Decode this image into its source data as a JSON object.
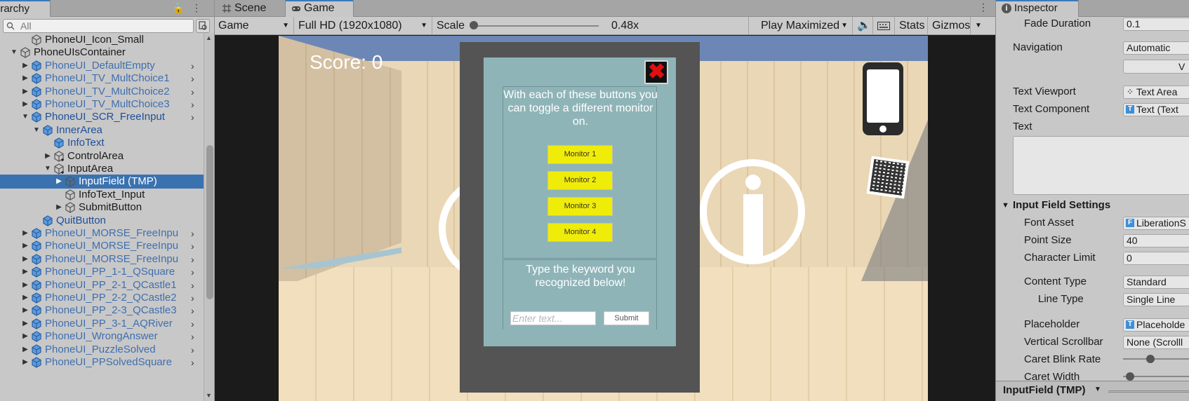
{
  "hierarchy": {
    "tab_label": "erarchy",
    "search_placeholder": "All",
    "rows": [
      {
        "label": "PhoneUI_Icon_Small",
        "depth": 2,
        "arrow": "",
        "kind": "object"
      },
      {
        "label": "PhoneUIsContainer",
        "depth": 1,
        "arrow": "down",
        "kind": "object"
      },
      {
        "label": "PhoneUI_DefaultEmpty",
        "depth": 2,
        "arrow": "right",
        "kind": "prefab",
        "chev": true
      },
      {
        "label": "PhoneUI_TV_MultChoice1",
        "depth": 2,
        "arrow": "right",
        "kind": "prefab",
        "chev": true
      },
      {
        "label": "PhoneUI_TV_MultChoice2",
        "depth": 2,
        "arrow": "right",
        "kind": "prefab",
        "chev": true
      },
      {
        "label": "PhoneUI_TV_MultChoice3",
        "depth": 2,
        "arrow": "right",
        "kind": "prefab",
        "chev": true
      },
      {
        "label": "PhoneUI_SCR_FreeInput",
        "depth": 2,
        "arrow": "down",
        "kind": "prefab-dark",
        "chev": true
      },
      {
        "label": "InnerArea",
        "depth": 3,
        "arrow": "down",
        "kind": "prefab-dark"
      },
      {
        "label": "InfoText",
        "depth": 4,
        "arrow": "",
        "kind": "prefab-dark"
      },
      {
        "label": "ControlArea",
        "depth": 4,
        "arrow": "right",
        "kind": "object-plus"
      },
      {
        "label": "InputArea",
        "depth": 4,
        "arrow": "down",
        "kind": "object-plus"
      },
      {
        "label": "InputField (TMP)",
        "depth": 5,
        "arrow": "right",
        "kind": "object",
        "selected": true
      },
      {
        "label": "InfoText_Input",
        "depth": 5,
        "arrow": "",
        "kind": "object"
      },
      {
        "label": "SubmitButton",
        "depth": 5,
        "arrow": "right",
        "kind": "object"
      },
      {
        "label": "QuitButton",
        "depth": 3,
        "arrow": "",
        "kind": "prefab-dark"
      },
      {
        "label": "PhoneUI_MORSE_FreeInpu",
        "depth": 2,
        "arrow": "right",
        "kind": "prefab",
        "chev": true
      },
      {
        "label": "PhoneUI_MORSE_FreeInpu",
        "depth": 2,
        "arrow": "right",
        "kind": "prefab",
        "chev": true
      },
      {
        "label": "PhoneUI_MORSE_FreeInpu",
        "depth": 2,
        "arrow": "right",
        "kind": "prefab",
        "chev": true
      },
      {
        "label": "PhoneUI_PP_1-1_QSquare",
        "depth": 2,
        "arrow": "right",
        "kind": "prefab",
        "chev": true
      },
      {
        "label": "PhoneUI_PP_2-1_QCastle1",
        "depth": 2,
        "arrow": "right",
        "kind": "prefab",
        "chev": true
      },
      {
        "label": "PhoneUI_PP_2-2_QCastle2",
        "depth": 2,
        "arrow": "right",
        "kind": "prefab",
        "chev": true
      },
      {
        "label": "PhoneUI_PP_2-3_QCastle3",
        "depth": 2,
        "arrow": "right",
        "kind": "prefab",
        "chev": true
      },
      {
        "label": "PhoneUI_PP_3-1_AQRiver",
        "depth": 2,
        "arrow": "right",
        "kind": "prefab",
        "chev": true
      },
      {
        "label": "PhoneUI_WrongAnswer",
        "depth": 2,
        "arrow": "right",
        "kind": "prefab",
        "chev": true
      },
      {
        "label": "PhoneUI_PuzzleSolved",
        "depth": 2,
        "arrow": "right",
        "kind": "prefab",
        "chev": true
      },
      {
        "label": "PhoneUI_PPSolvedSquare",
        "depth": 2,
        "arrow": "right",
        "kind": "prefab",
        "chev": true
      }
    ]
  },
  "game_tabs": {
    "scene_label": "Scene",
    "game_label": "Game"
  },
  "game_toolbar": {
    "display": "Game",
    "resolution": "Full HD (1920x1080)",
    "scale_label": "Scale",
    "scale_value": "0.48x",
    "play_mode": "Play Maximized",
    "stats": "Stats",
    "gizmos": "Gizmos"
  },
  "game_view": {
    "score": "Score: 0",
    "info_text": "With each of these buttons you can toggle a different monitor on.",
    "monitor_buttons": [
      "Monitor 1",
      "Monitor 2",
      "Monitor 3",
      "Monitor 4"
    ],
    "input_prompt": "Type the keyword you recognized below!",
    "input_placeholder": "Enter text...",
    "submit_label": "Submit",
    "close_symbol": "✖"
  },
  "inspector": {
    "tab_label": "Inspector",
    "fade_duration_label": "Fade Duration",
    "fade_duration_value": "0.1",
    "navigation_label": "Navigation",
    "navigation_value": "Automatic",
    "visualize_btn": "V",
    "text_viewport_label": "Text Viewport",
    "text_viewport_value": "Text Area",
    "text_component_label": "Text Component",
    "text_component_value": "Text (Text",
    "text_label": "Text",
    "section_title": "Input Field Settings",
    "font_asset_label": "Font Asset",
    "font_asset_value": "LiberationS",
    "point_size_label": "Point Size",
    "point_size_value": "40",
    "char_limit_label": "Character Limit",
    "char_limit_value": "0",
    "content_type_label": "Content Type",
    "content_type_value": "Standard",
    "line_type_label": "Line Type",
    "line_type_value": "Single Line",
    "placeholder_label": "Placeholder",
    "placeholder_value": "Placeholde",
    "vscrollbar_label": "Vertical Scrollbar",
    "vscrollbar_value": "None (Scrolll",
    "caret_blink_label": "Caret Blink Rate",
    "caret_blink_fraction": 0.38,
    "caret_width_label": "Caret Width",
    "caret_width_fraction": 0.05,
    "bottom_object": "InputField (TMP)"
  },
  "colors": {
    "selection": "#3a72b0",
    "accent_tab": "#3a79bb",
    "monitor_button": "#f0ec0a",
    "phone_screen": "#8fb4b8",
    "close_x": "#e01010"
  }
}
